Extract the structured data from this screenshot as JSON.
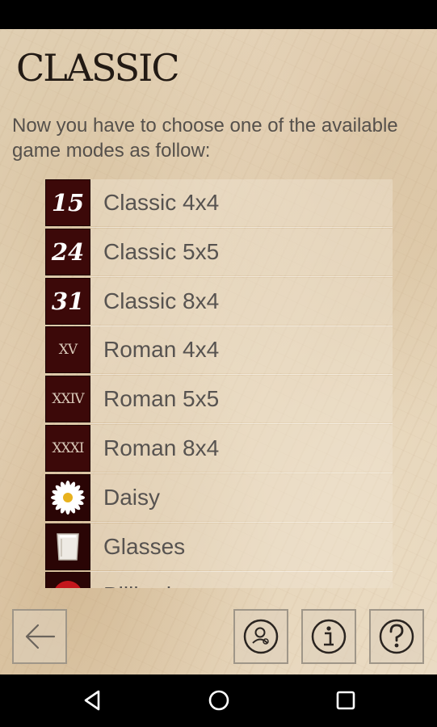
{
  "header": {
    "title": "CLASSIC",
    "intro": "Now you have to choose one of the available game modes as follow:"
  },
  "modes": [
    {
      "tile_text": "15",
      "tile_style": "number",
      "label": "Classic 4x4"
    },
    {
      "tile_text": "24",
      "tile_style": "number",
      "label": "Classic 5x5"
    },
    {
      "tile_text": "31",
      "tile_style": "number",
      "label": "Classic 8x4"
    },
    {
      "tile_text": "XV",
      "tile_style": "roman",
      "label": "Roman 4x4"
    },
    {
      "tile_text": "XXIV",
      "tile_style": "roman",
      "label": "Roman 5x5"
    },
    {
      "tile_text": "XXXI",
      "tile_style": "roman",
      "label": "Roman 8x4"
    },
    {
      "tile_text": "",
      "tile_style": "daisy-icon",
      "label": "Daisy"
    },
    {
      "tile_text": "",
      "tile_style": "glass-icon",
      "label": "Glasses"
    },
    {
      "tile_text": "",
      "tile_style": "billiard-ball-icon",
      "label": "Billiard"
    }
  ],
  "toolbar": {
    "back_icon": "arrow-left-icon",
    "profile_icon": "user-profile-icon",
    "info_icon": "info-icon",
    "help_icon": "question-icon"
  },
  "system_nav": {
    "back_icon": "triangle-back-icon",
    "home_icon": "circle-home-icon",
    "recents_icon": "square-recents-icon"
  },
  "colors": {
    "tile": "#3c0909",
    "text": "#575350",
    "title": "#221a14"
  }
}
